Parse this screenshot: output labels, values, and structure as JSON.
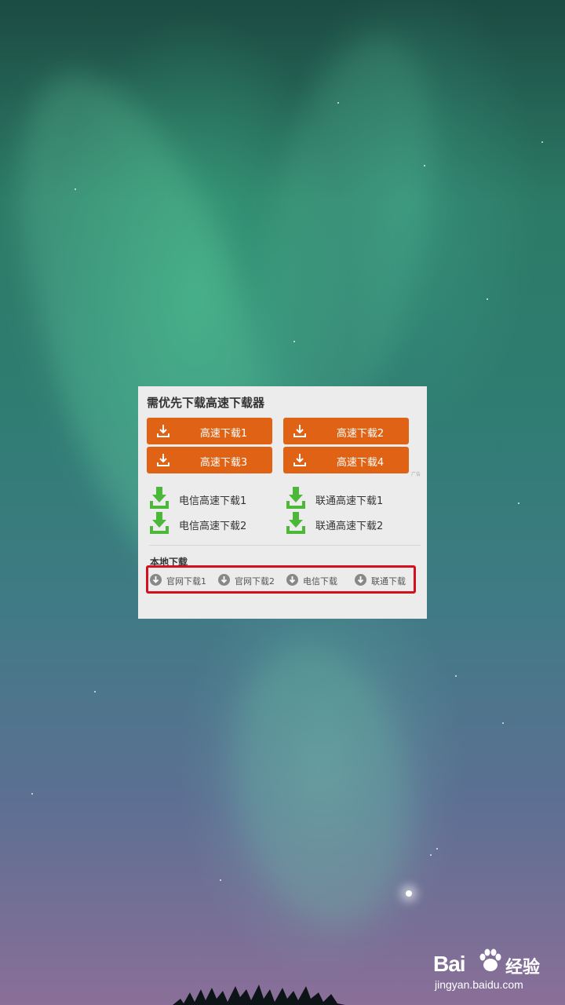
{
  "panel": {
    "title": "需优先下载高速下载器",
    "ad_label": "广告",
    "orange_buttons": [
      {
        "label": "高速下载1"
      },
      {
        "label": "高速下载2"
      },
      {
        "label": "高速下载3"
      },
      {
        "label": "高速下载4"
      }
    ],
    "green_links": [
      {
        "label": "电信高速下载1"
      },
      {
        "label": "联通高速下载1"
      },
      {
        "label": "电信高速下载2"
      },
      {
        "label": "联通高速下载2"
      }
    ],
    "local_title": "本地下载",
    "local_links": [
      {
        "label": "官网下载1"
      },
      {
        "label": "官网下载2"
      },
      {
        "label": "电信下载"
      },
      {
        "label": "联通下载"
      }
    ]
  },
  "watermark": {
    "brand": "Bai",
    "brand_suffix": "经验",
    "url": "jingyan.baidu.com"
  },
  "colors": {
    "orange": "#e06315",
    "green": "#4cb83a",
    "highlight_red": "#d60f1e",
    "panel_bg": "#ececec"
  },
  "icons": {
    "orange_button": "download-icon",
    "green_link": "download-arrow-icon",
    "local_link": "circle-down-arrow-icon",
    "watermark": "paw-icon"
  }
}
